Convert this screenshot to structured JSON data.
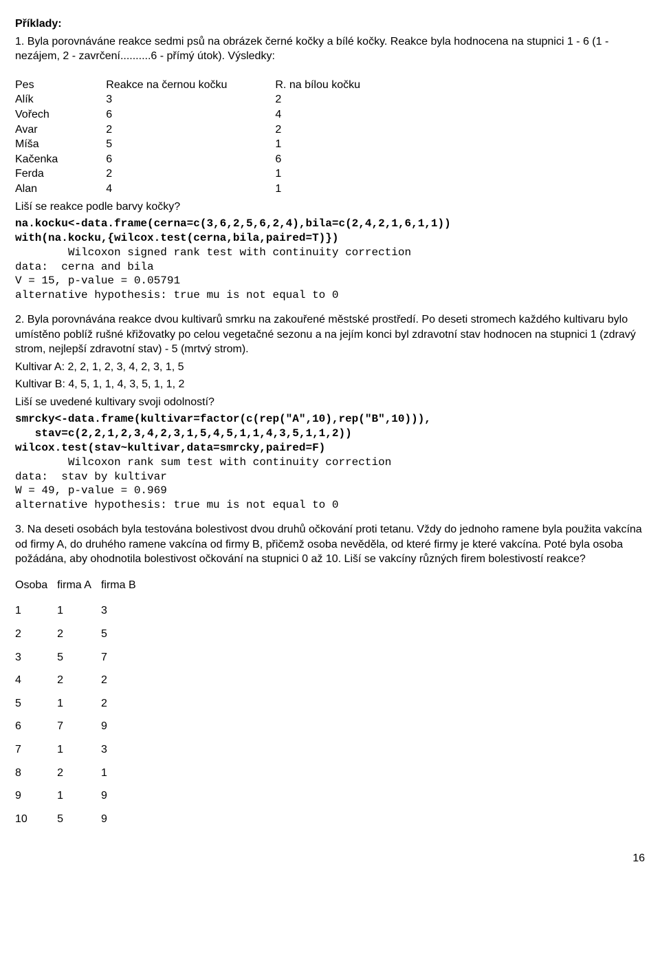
{
  "heading": "Příklady:",
  "ex1_intro": "1. Byla porovnáváne reakce sedmi psů na obrázek černé kočky a bílé kočky. Reakce byla hodnocena na stupnici 1 - 6 (1 - nezájem, 2 - zavrčení..........6 - přímý útok). Výsledky:",
  "ex1_table": {
    "headers": [
      "Pes",
      "Reakce na černou kočku",
      "R. na bílou kočku"
    ],
    "rows": [
      [
        "Alík",
        "3",
        "2"
      ],
      [
        "Vořech",
        "6",
        "4"
      ],
      [
        "Avar",
        "2",
        "2"
      ],
      [
        "Míša",
        "5",
        "1"
      ],
      [
        "Kačenka",
        "6",
        "6"
      ],
      [
        "Ferda",
        "2",
        "1"
      ],
      [
        "Alan",
        "4",
        "1"
      ]
    ]
  },
  "ex1_question": "Liší se reakce podle barvy kočky?",
  "ex1_code1": "na.kocku<-data.frame(cerna=c(3,6,2,5,6,2,4),bila=c(2,4,2,1,6,1,1))",
  "ex1_code2": "with(na.kocku,{wilcox.test(cerna,bila,paired=T)})",
  "ex1_out1": "        Wilcoxon signed rank test with continuity correction",
  "ex1_out2": "data:  cerna and bila",
  "ex1_out3": "V = 15, p-value = 0.05791",
  "ex1_out4": "alternative hypothesis: true mu is not equal to 0",
  "ex2_para": "2. Byla porovnávána reakce dvou kultivarů smrku na zakouřené městské prostředí. Po deseti stromech každého kultivaru bylo umístěno poblíž rušné křižovatky po celou vegetačné sezonu a na jejím konci byl zdravotní stav hodnocen na stupnici 1 (zdravý strom, nejlepší zdravotní stav) - 5 (mrtvý strom).",
  "ex2_a": "Kultivar A: 2, 2, 1, 2, 3, 4, 2, 3, 1, 5",
  "ex2_b": "Kultivar B: 4, 5, 1, 1, 4, 3, 5, 1, 1, 2",
  "ex2_question": "Liší se uvedené kultivary svoji odolností?",
  "ex2_code1": "smrcky<-data.frame(kultivar=factor(c(rep(\"A\",10),rep(\"B\",10))),",
  "ex2_code2": "   stav=c(2,2,1,2,3,4,2,3,1,5,4,5,1,1,4,3,5,1,1,2))",
  "ex2_code3": "wilcox.test(stav~kultivar,data=smrcky,paired=F)",
  "ex2_out1": "        Wilcoxon rank sum test with continuity correction",
  "ex2_out2": "data:  stav by kultivar",
  "ex2_out3": "W = 49, p-value = 0.969",
  "ex2_out4": "alternative hypothesis: true mu is not equal to 0",
  "ex3_para": "3. Na deseti osobách byla testována bolestivost dvou druhů očkování proti tetanu. Vždy do jednoho ramene byla použita vakcína od firmy A, do druhého ramene vakcína od firmy B, přičemž osoba nevěděla, od které firmy je které vakcína. Poté byla osoba požádána, aby ohodnotila bolestivost očkování na stupnici 0 až 10. Liší se vakcíny různých firem bolestivostí reakce?",
  "ex3_table": {
    "headers": [
      "Osoba",
      "firma A",
      "firma B"
    ],
    "rows": [
      [
        "1",
        "1",
        "3"
      ],
      [
        "2",
        "2",
        "5"
      ],
      [
        "3",
        "5",
        "7"
      ],
      [
        "4",
        "2",
        "2"
      ],
      [
        "5",
        "1",
        "2"
      ],
      [
        "6",
        "7",
        "9"
      ],
      [
        "7",
        "1",
        "3"
      ],
      [
        "8",
        "2",
        "1"
      ],
      [
        "9",
        "1",
        "9"
      ],
      [
        "10",
        "5",
        "9"
      ]
    ]
  },
  "pagenum": "16"
}
